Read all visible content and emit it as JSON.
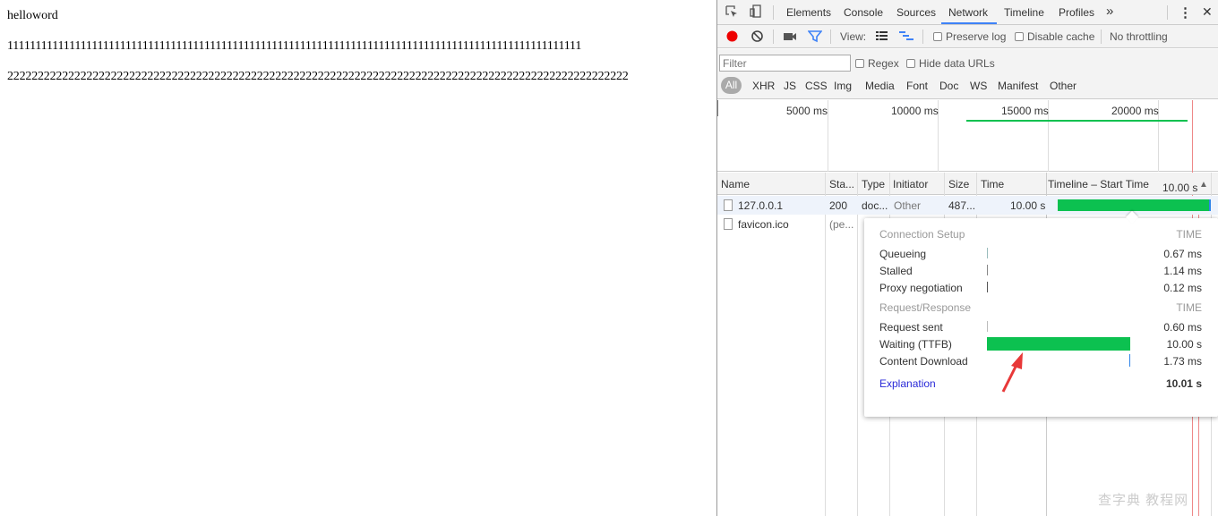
{
  "webpage": {
    "line1": "helloword",
    "line2": "111111111111111111111111111111111111111111111111111111111111111111111111111111111111111111111111111111",
    "line3": "222222222222222222222222222222222222222222222222222222222222222222222222222222222222222222222222222222"
  },
  "devtools": {
    "tabs": [
      "Elements",
      "Console",
      "Sources",
      "Network",
      "Timeline",
      "Profiles"
    ],
    "active_tab": "Network",
    "more_tabs": "»",
    "more_menu": "⋮",
    "close": "✕",
    "toolbar": {
      "view_label": "View:",
      "preserve_log": "Preserve log",
      "disable_cache": "Disable cache",
      "throttling": "No throttling"
    },
    "filter": {
      "placeholder": "Filter",
      "regex": "Regex",
      "hide_data_urls": "Hide data URLs"
    },
    "type_filters": [
      "All",
      "XHR",
      "JS",
      "CSS",
      "Img",
      "Media",
      "Font",
      "Doc",
      "WS",
      "Manifest",
      "Other"
    ],
    "overview_ticks": [
      "5000 ms",
      "10000 ms",
      "15000 ms",
      "20000 ms"
    ],
    "columns": {
      "name": "Name",
      "status": "Sta...",
      "type": "Type",
      "initiator": "Initiator",
      "size": "Size",
      "time": "Time",
      "timeline": "Timeline – Start Time",
      "timeline_value": "10.00 s",
      "sort_icon": "▲"
    },
    "rows": [
      {
        "name": "127.0.0.1",
        "status": "200",
        "type": "doc...",
        "initiator": "Other",
        "size": "487...",
        "time": "10.00 s"
      },
      {
        "name": "favicon.ico",
        "status": "(pe..."
      }
    ],
    "timing": {
      "header1": "Connection Setup",
      "time1": "TIME",
      "queueing": "Queueing",
      "queueing_v": "0.67 ms",
      "stalled": "Stalled",
      "stalled_v": "1.14 ms",
      "proxy": "Proxy negotiation",
      "proxy_v": "0.12 ms",
      "header2": "Request/Response",
      "time2": "TIME",
      "sent": "Request sent",
      "sent_v": "0.60 ms",
      "waiting": "Waiting (TTFB)",
      "waiting_v": "10.00 s",
      "download": "Content Download",
      "download_v": "1.73 ms",
      "explanation": "Explanation",
      "total": "10.01 s"
    },
    "colors": {
      "accent": "#3e82f7",
      "bar_green": "#0cc150",
      "record_red": "#e00",
      "arrow_red": "#e83838"
    },
    "watermark": "查字典 教程网"
  }
}
